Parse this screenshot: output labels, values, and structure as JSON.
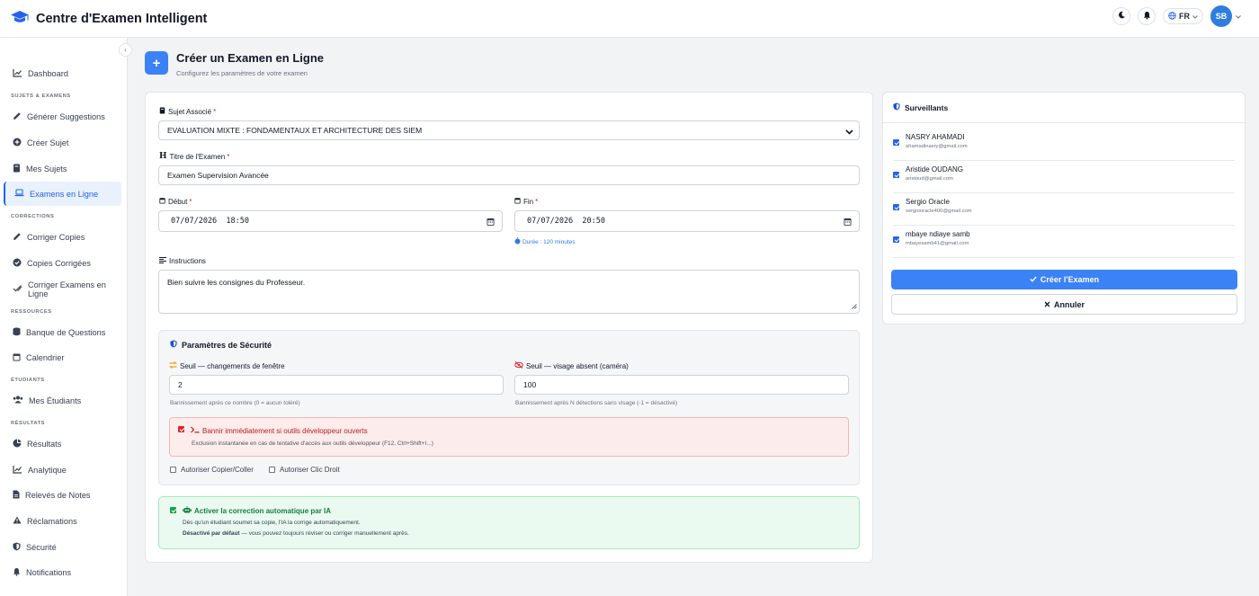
{
  "app": {
    "title": "Centre d'Examen Intelligent",
    "lang": "FR",
    "user_initials": "SB"
  },
  "sidebar": {
    "dashboard": "Dashboard",
    "sections": [
      "SUJETS & EXAMENS",
      "CORRECTIONS",
      "RESSOURCES",
      "ÉTUDIANTS",
      "RÉSULTATS"
    ],
    "items": [
      "Générer Suggestions",
      "Créer Sujet",
      "Mes Sujets",
      "Examens en Ligne",
      "Corriger Copies",
      "Copies Corrigées",
      "Corriger Examens en Ligne",
      "Banque de Questions",
      "Calendrier",
      "Mes Étudiants",
      "Résultats",
      "Analytique",
      "Relevés de Notes",
      "Réclamations",
      "Sécurité",
      "Notifications"
    ]
  },
  "header": {
    "title": "Créer un Examen en Ligne",
    "subtitle": "Configurez les paramètres de votre examen"
  },
  "form": {
    "subject_label": "Sujet Associé",
    "subject_value": "EVALUATION MIXTE : FONDAMENTAUX ET ARCHITECTURE DES SIEM",
    "title_label": "Titre de l'Examen",
    "title_value": "Examen Supervision Avancée",
    "start_label": "Début",
    "start_value": "07/07/2026  18:50",
    "end_label": "Fin",
    "end_value": "07/07/2026  20:50",
    "duration": "Durée : 120 minutes",
    "instructions_label": "Instructions",
    "instructions_value": "Bien suivre les consignes du Professeur.",
    "required": "*"
  },
  "security": {
    "title": "Paramètres de Sécurité",
    "window_label": "Seuil — changements de fenêtre",
    "window_value": "2",
    "window_hint": "Bannissement après ce nombre (0 = aucun toléré)",
    "face_label": "Seuil — visage absent (caméra)",
    "face_value": "100",
    "face_hint": "Bannissement après N détections sans visage (-1 = désactivé)",
    "devtools_label": "Bannir immédiatement si outils développeur ouverts",
    "devtools_hint": "Exclusion instantanée en cas de tentative d'accès aux outils développeur (F12, Ctrl+Shift+I...)",
    "copy_label": "Autoriser Copier/Coller",
    "rightclick_label": "Autoriser Clic Droit"
  },
  "ai": {
    "label": "Activer la correction automatique par IA",
    "desc": "Dès qu'un étudiant soumet sa copie, l'IA la corrige automatiquement.",
    "bold": "Désactivé par défaut",
    "rest": " — vous pouvez toujours réviser ou corriger manuellement après."
  },
  "supervisors": {
    "title": "Surveillants",
    "list": [
      {
        "name": "NASRY AHAMADI",
        "email": "ahamadinasry@gmail.com"
      },
      {
        "name": "Aristide OUDANG",
        "email": "aristoud@gmail.com"
      },
      {
        "name": "Sergio Oracle",
        "email": "sergiooracle400@gmail.com"
      },
      {
        "name": "mbaye ndiaye samb",
        "email": "mbayesamb41@gmail.com"
      }
    ]
  },
  "actions": {
    "create": "Créer l'Examen",
    "cancel": "Annuler"
  },
  "colors": {
    "primary": "#3b82f6",
    "danger": "#dc2626",
    "success": "#15803d"
  }
}
